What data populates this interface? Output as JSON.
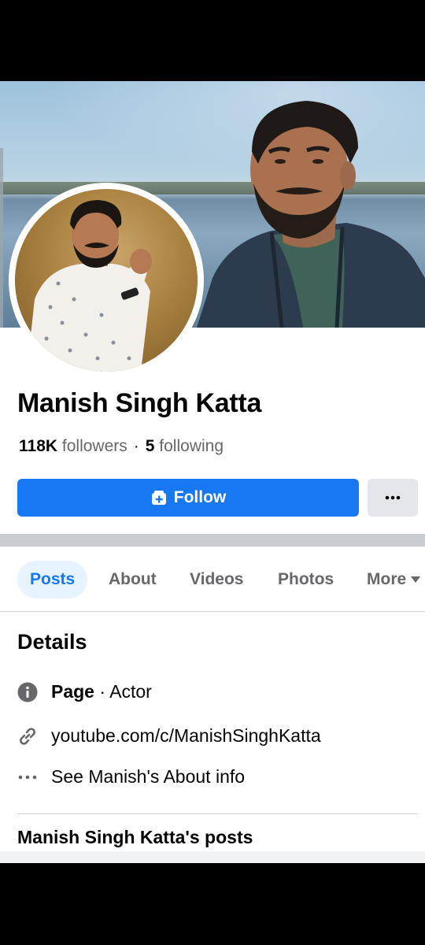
{
  "profile": {
    "name": "Manish Singh Katta",
    "followers_count": "118K",
    "followers_label": "followers",
    "following_count": "5",
    "following_label": "following"
  },
  "actions": {
    "follow_label": "Follow",
    "more_label": "•••"
  },
  "tabs": [
    {
      "label": "Posts",
      "active": true
    },
    {
      "label": "About",
      "active": false
    },
    {
      "label": "Videos",
      "active": false
    },
    {
      "label": "Photos",
      "active": false
    },
    {
      "label": "More",
      "active": false
    }
  ],
  "details": {
    "title": "Details",
    "category_prefix": "Page",
    "category_value": "· Actor",
    "link": "youtube.com/c/ManishSinghKatta",
    "about_link": "See Manish's About info"
  },
  "posts_section_title": "Manish Singh Katta's posts",
  "colors": {
    "accent": "#1877f2",
    "tab_active_bg": "#e7f3ff",
    "secondary_text": "#65676b",
    "button_gray": "#e4e6eb"
  },
  "icons": {
    "follow": "follow-plus-icon",
    "category": "info-icon",
    "link": "link-icon",
    "about": "ellipsis-icon",
    "tab_more": "caret-down-icon"
  }
}
